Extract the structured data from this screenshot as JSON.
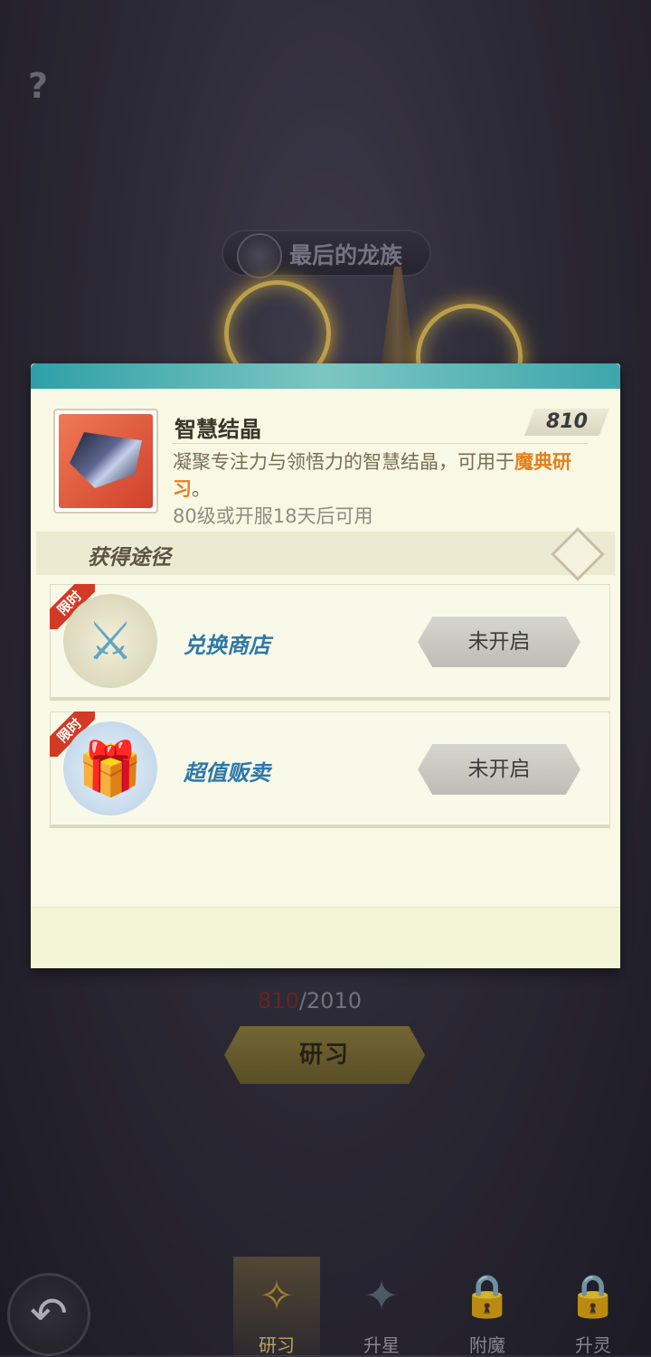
{
  "background": {
    "help_icon": "question-icon",
    "help_glyph": "?",
    "title": "最后的龙族",
    "material_count_current": "810",
    "material_count_total": "/2010",
    "study_button": "研习"
  },
  "popup": {
    "item_name": "智慧结晶",
    "item_quantity": "810",
    "description_prefix": "凝聚专注力与领悟力的智慧结晶，可用于",
    "description_highlight": "魔典研习",
    "description_suffix": "。",
    "requirement": "80级或开服18天后可用",
    "sources_title": "获得途径",
    "sources": [
      {
        "tag": "限时",
        "label": "兑换商店",
        "button": "未开启",
        "icon": "shop-sword-icon"
      },
      {
        "tag": "限时",
        "label": "超值贩卖",
        "button": "未开启",
        "icon": "treasure-chest-icon"
      }
    ]
  },
  "bottom_nav": {
    "back_icon": "back-arrow-icon",
    "tabs": [
      {
        "label": "研习",
        "icon": "study-icon",
        "active": true
      },
      {
        "label": "升星",
        "icon": "star-icon",
        "active": false
      },
      {
        "label": "附魔",
        "icon": "enchant-lock-icon",
        "active": false
      },
      {
        "label": "升灵",
        "icon": "spirit-lock-icon",
        "active": false
      }
    ]
  },
  "colors": {
    "highlight": "#e2801d",
    "card_label": "#2e78a8",
    "popup_bg": "#f8f8e4",
    "header_bar": "#2fa0a8"
  }
}
